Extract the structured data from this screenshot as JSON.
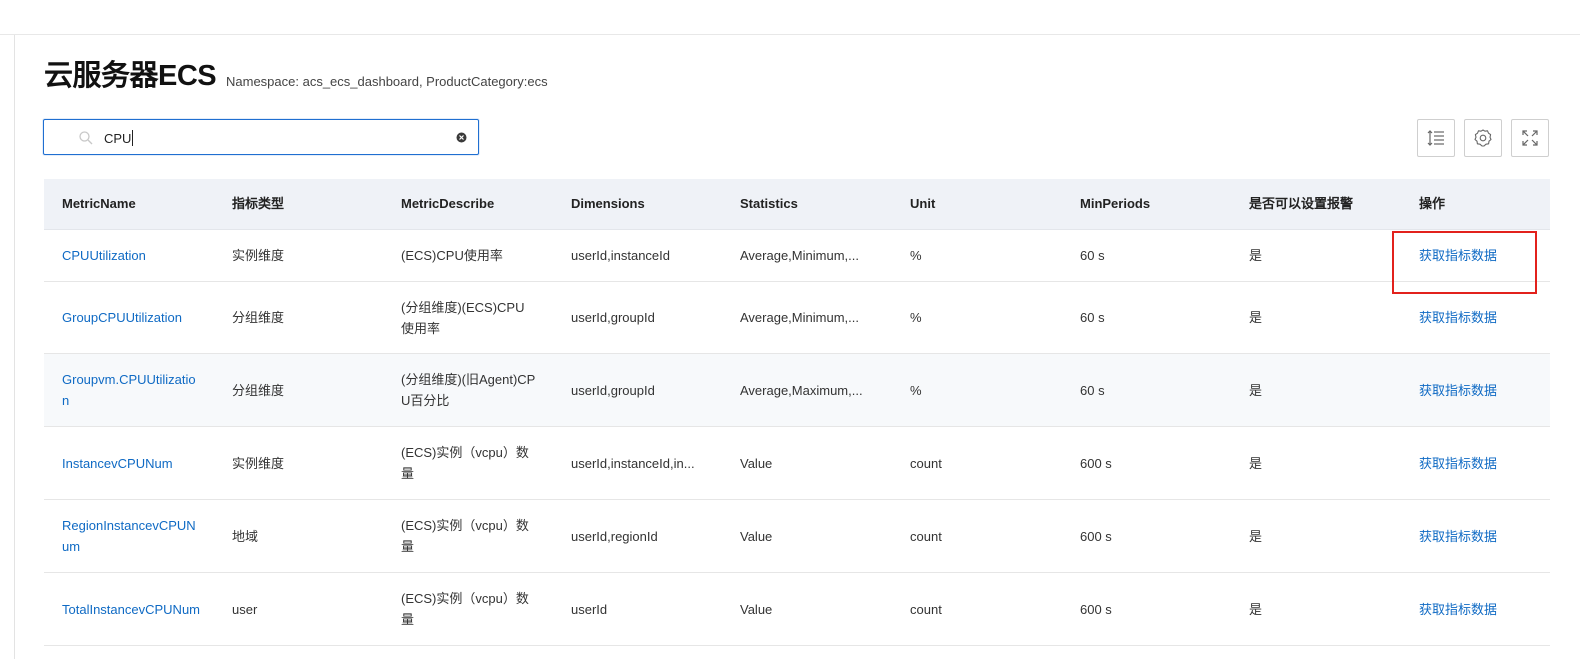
{
  "page": {
    "title": "云服务器ECS",
    "subtitle": "Namespace: acs_ecs_dashboard, ProductCategory:ecs"
  },
  "search": {
    "value": "CPU",
    "placeholder": ""
  },
  "toolbar": {
    "icons": [
      "column-settings-icon",
      "gear-icon",
      "fullscreen-icon"
    ]
  },
  "table": {
    "columns": [
      "MetricName",
      "指标类型",
      "MetricDescribe",
      "Dimensions",
      "Statistics",
      "Unit",
      "MinPeriods",
      "是否可以设置报警",
      "操作"
    ],
    "rows": [
      {
        "metric": "CPUUtilization",
        "type": "实例维度",
        "describe": "(ECS)CPU使用率",
        "dimensions": "userId,instanceId",
        "statistics": "Average,Minimum,...",
        "unit": "%",
        "min_periods": "60 s",
        "alarm": "是",
        "action": "获取指标数据"
      },
      {
        "metric": "GroupCPUUtilization",
        "type": "分组维度",
        "describe": "(分组维度)(ECS)CPU使用率",
        "dimensions": "userId,groupId",
        "statistics": "Average,Minimum,...",
        "unit": "%",
        "min_periods": "60 s",
        "alarm": "是",
        "action": "获取指标数据"
      },
      {
        "metric": "Groupvm.CPUUtilization",
        "type": "分组维度",
        "describe": "(分组维度)(旧Agent)CPU百分比",
        "dimensions": "userId,groupId",
        "statistics": "Average,Maximum,...",
        "unit": "%",
        "min_periods": "60 s",
        "alarm": "是",
        "action": "获取指标数据"
      },
      {
        "metric": "InstancevCPUNum",
        "type": "实例维度",
        "describe": "(ECS)实例（vcpu）数量",
        "dimensions": "userId,instanceId,in...",
        "statistics": "Value",
        "unit": "count",
        "min_periods": "600 s",
        "alarm": "是",
        "action": "获取指标数据"
      },
      {
        "metric": "RegionInstancevCPUNum",
        "type": "地域",
        "describe": "(ECS)实例（vcpu）数量",
        "dimensions": "userId,regionId",
        "statistics": "Value",
        "unit": "count",
        "min_periods": "600 s",
        "alarm": "是",
        "action": "获取指标数据"
      },
      {
        "metric": "TotalInstancevCPUNum",
        "type": "user",
        "describe": "(ECS)实例（vcpu）数量",
        "dimensions": "userId",
        "statistics": "Value",
        "unit": "count",
        "min_periods": "600 s",
        "alarm": "是",
        "action": "获取指标数据"
      }
    ]
  },
  "colors": {
    "accent": "#0f6ac4",
    "header_bg": "#eff2f7",
    "highlight": "#e2211c"
  }
}
